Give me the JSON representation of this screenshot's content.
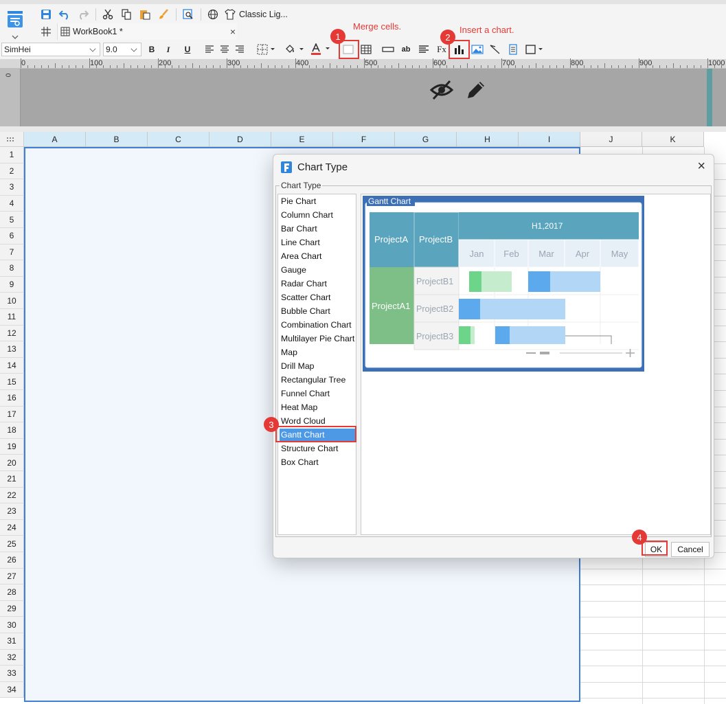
{
  "toolbar": {
    "theme_label": "Classic Lig...",
    "tab_name": "WorkBook1 *",
    "tab_close": "×",
    "font_name": "SimHei",
    "font_size": "9.0",
    "bold": "B",
    "italic": "I",
    "underline": "U",
    "wrap_text": "ab",
    "formula": "Fx"
  },
  "callouts": [
    {
      "num": "1",
      "text": "Merge cells."
    },
    {
      "num": "2",
      "text": "Insert a chart."
    },
    {
      "num": "3",
      "text": ""
    },
    {
      "num": "4",
      "text": ""
    }
  ],
  "ruler": {
    "labels": [
      "0",
      "100",
      "200",
      "300",
      "400",
      "500",
      "600",
      "700",
      "800",
      "900",
      "1000"
    ],
    "vertical_label": "0"
  },
  "sheet": {
    "columns": [
      "A",
      "B",
      "C",
      "D",
      "E",
      "F",
      "G",
      "H",
      "I",
      "J",
      "K"
    ],
    "rows": [
      "1",
      "2",
      "3",
      "4",
      "5",
      "6",
      "7",
      "8",
      "9",
      "10",
      "11",
      "12",
      "13",
      "14",
      "15",
      "16",
      "17",
      "18",
      "19",
      "20",
      "21",
      "22",
      "23",
      "24",
      "25",
      "26",
      "27",
      "28",
      "29",
      "30",
      "31",
      "32",
      "33",
      "34"
    ]
  },
  "dialog": {
    "title": "Chart Type",
    "close": "×",
    "group_label": "Chart Type",
    "chart_types": [
      "Pie Chart",
      "Column Chart",
      "Bar Chart",
      "Line Chart",
      "Area Chart",
      "Gauge",
      "Radar Chart",
      "Scatter Chart",
      "Bubble Chart",
      "Combination Chart",
      "Multilayer Pie Chart",
      "Map",
      "Drill Map",
      "Rectangular Tree",
      "Funnel Chart",
      "Heat Map",
      "Word Cloud",
      "Gantt Chart",
      "Structure Chart",
      "Box Chart"
    ],
    "selected": "Gantt Chart",
    "ok": "OK",
    "cancel": "Cancel"
  },
  "gantt_preview": {
    "caption": "Gantt Chart",
    "col_a": "ProjectA",
    "col_b": "ProjectB",
    "period": "H1,2017",
    "months": [
      "Jan",
      "Feb",
      "Mar",
      "Apr",
      "May"
    ],
    "group": "ProjectA1",
    "tasks": [
      "ProjectB1",
      "ProjectB2",
      "ProjectB3"
    ]
  },
  "colors": {
    "accent": "#3f7fd8",
    "callout": "#e53935",
    "selection": "#4d99e6",
    "gantt_frame": "#3d6fb5",
    "gantt_header": "#5aa4be",
    "gantt_group": "#7dbf86",
    "bar_blue": "#5ca9ee",
    "bar_blue_light": "#b2d6f6",
    "bar_green": "#6cd58a",
    "bar_green_light": "#c6ecce"
  }
}
